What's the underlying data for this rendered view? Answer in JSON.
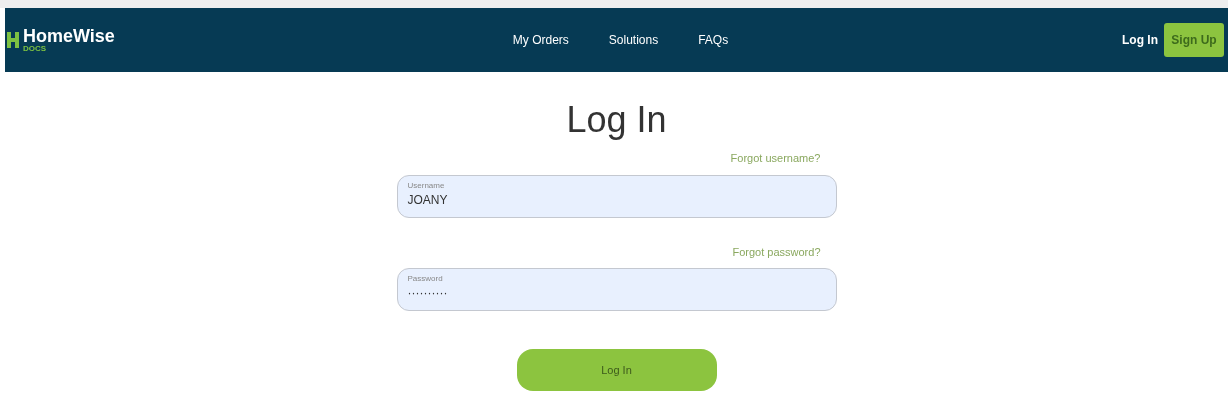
{
  "brand": {
    "name": "HomeWise",
    "sub": "DOCS"
  },
  "nav": {
    "links": [
      {
        "label": "My Orders"
      },
      {
        "label": "Solutions"
      },
      {
        "label": "FAQs"
      }
    ],
    "login": "Log In",
    "signup": "Sign Up"
  },
  "form": {
    "title": "Log In",
    "fields": [
      {
        "link": "Forgot username?",
        "label": "Username",
        "value": "JOANY"
      },
      {
        "link": "Forgot password?",
        "label": "Password",
        "value": "··········"
      }
    ],
    "submit": "Log In"
  }
}
